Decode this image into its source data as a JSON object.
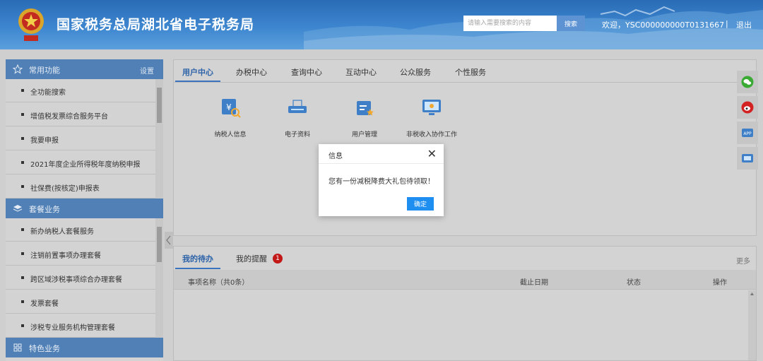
{
  "header": {
    "site_title": "国家税务总局湖北省电子税务局",
    "search_placeholder": "请输入需要搜索的内容",
    "search_button": "搜索",
    "welcome": "欢迎，YSC000000000T0131667",
    "separator": "|",
    "logout": "退出"
  },
  "sidebar": {
    "sections": [
      {
        "title": "常用功能",
        "icon": "star-icon",
        "action": "设置",
        "items": [
          "全功能搜索",
          "增值税发票综合服务平台",
          "我要申报",
          "2021年度企业所得税年度纳税申报",
          "社保费(按核定)申报表"
        ]
      },
      {
        "title": "套餐业务",
        "icon": "layers-icon",
        "items": [
          "新办纳税人套餐服务",
          "注销前置事项办理套餐",
          "跨区域涉税事项综合办理套餐",
          "发票套餐",
          "涉税专业服务机构管理套餐"
        ]
      },
      {
        "title": "特色业务",
        "icon": "grid-icon",
        "items": []
      }
    ]
  },
  "top_panel": {
    "tabs": [
      "用户中心",
      "办税中心",
      "查询中心",
      "互动中心",
      "公众服务",
      "个性服务"
    ],
    "active_tab": "用户中心",
    "tiles": [
      {
        "label": "纳税人信息",
        "icon": "taxpayer-info-icon"
      },
      {
        "label": "电子资料",
        "icon": "e-document-icon"
      },
      {
        "label": "用户管理",
        "icon": "user-management-icon"
      },
      {
        "label": "非税收入协作工作",
        "icon": "non-tax-revenue-icon"
      }
    ]
  },
  "bottom_panel": {
    "tabs": [
      "我的待办",
      "我的提醒"
    ],
    "active_tab": "我的待办",
    "reminder_count": "1",
    "more": "更多",
    "columns": [
      "事项名称（共0条）",
      "截止日期",
      "状态",
      "操作"
    ]
  },
  "right_tools": [
    "wechat-icon",
    "weibo-icon",
    "app-icon",
    "app-alt-icon"
  ],
  "dialog": {
    "title": "信息",
    "close": "✕",
    "message": "您有一份减税降费大礼包待领取！",
    "ok": "确定"
  },
  "colors": {
    "header_blue": "#2a6cb6",
    "section_head": "#5080b5",
    "accent": "#2c62a8",
    "ok_button": "#1e8ff0",
    "badge": "#c21818"
  }
}
